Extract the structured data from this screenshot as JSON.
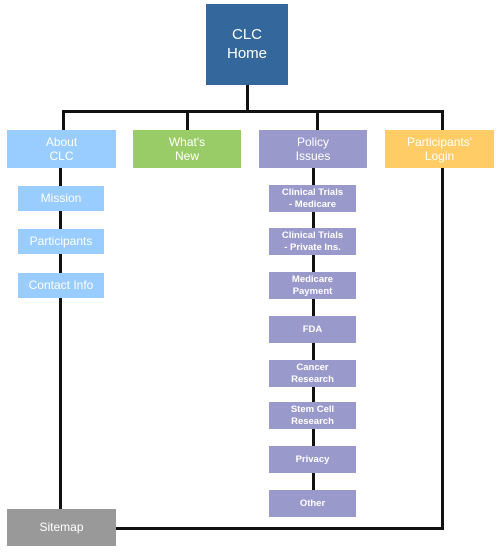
{
  "diagram": {
    "type": "sitemap",
    "root": {
      "label": "CLC\nHome",
      "color": "#34679b"
    },
    "sections": [
      {
        "label": "About\nCLC",
        "color": "#99ccff",
        "children": [
          "Mission",
          "Participants",
          "Contact Info"
        ]
      },
      {
        "label": "What's\nNew",
        "color": "#99cc66",
        "children": []
      },
      {
        "label": "Policy\nIssues",
        "color": "#9999cc",
        "children": [
          "Clinical Trials\n- Medicare",
          "Clinical Trials\n- Private Ins.",
          "Medicare\nPayment",
          "FDA",
          "Cancer\nResearch",
          "Stem Cell\nResearch",
          "Privacy",
          "Other"
        ]
      },
      {
        "label": "Participants'\nLogin",
        "color": "#ffcc66",
        "children": []
      }
    ],
    "footer": {
      "label": "Sitemap",
      "color": "#999999"
    }
  }
}
